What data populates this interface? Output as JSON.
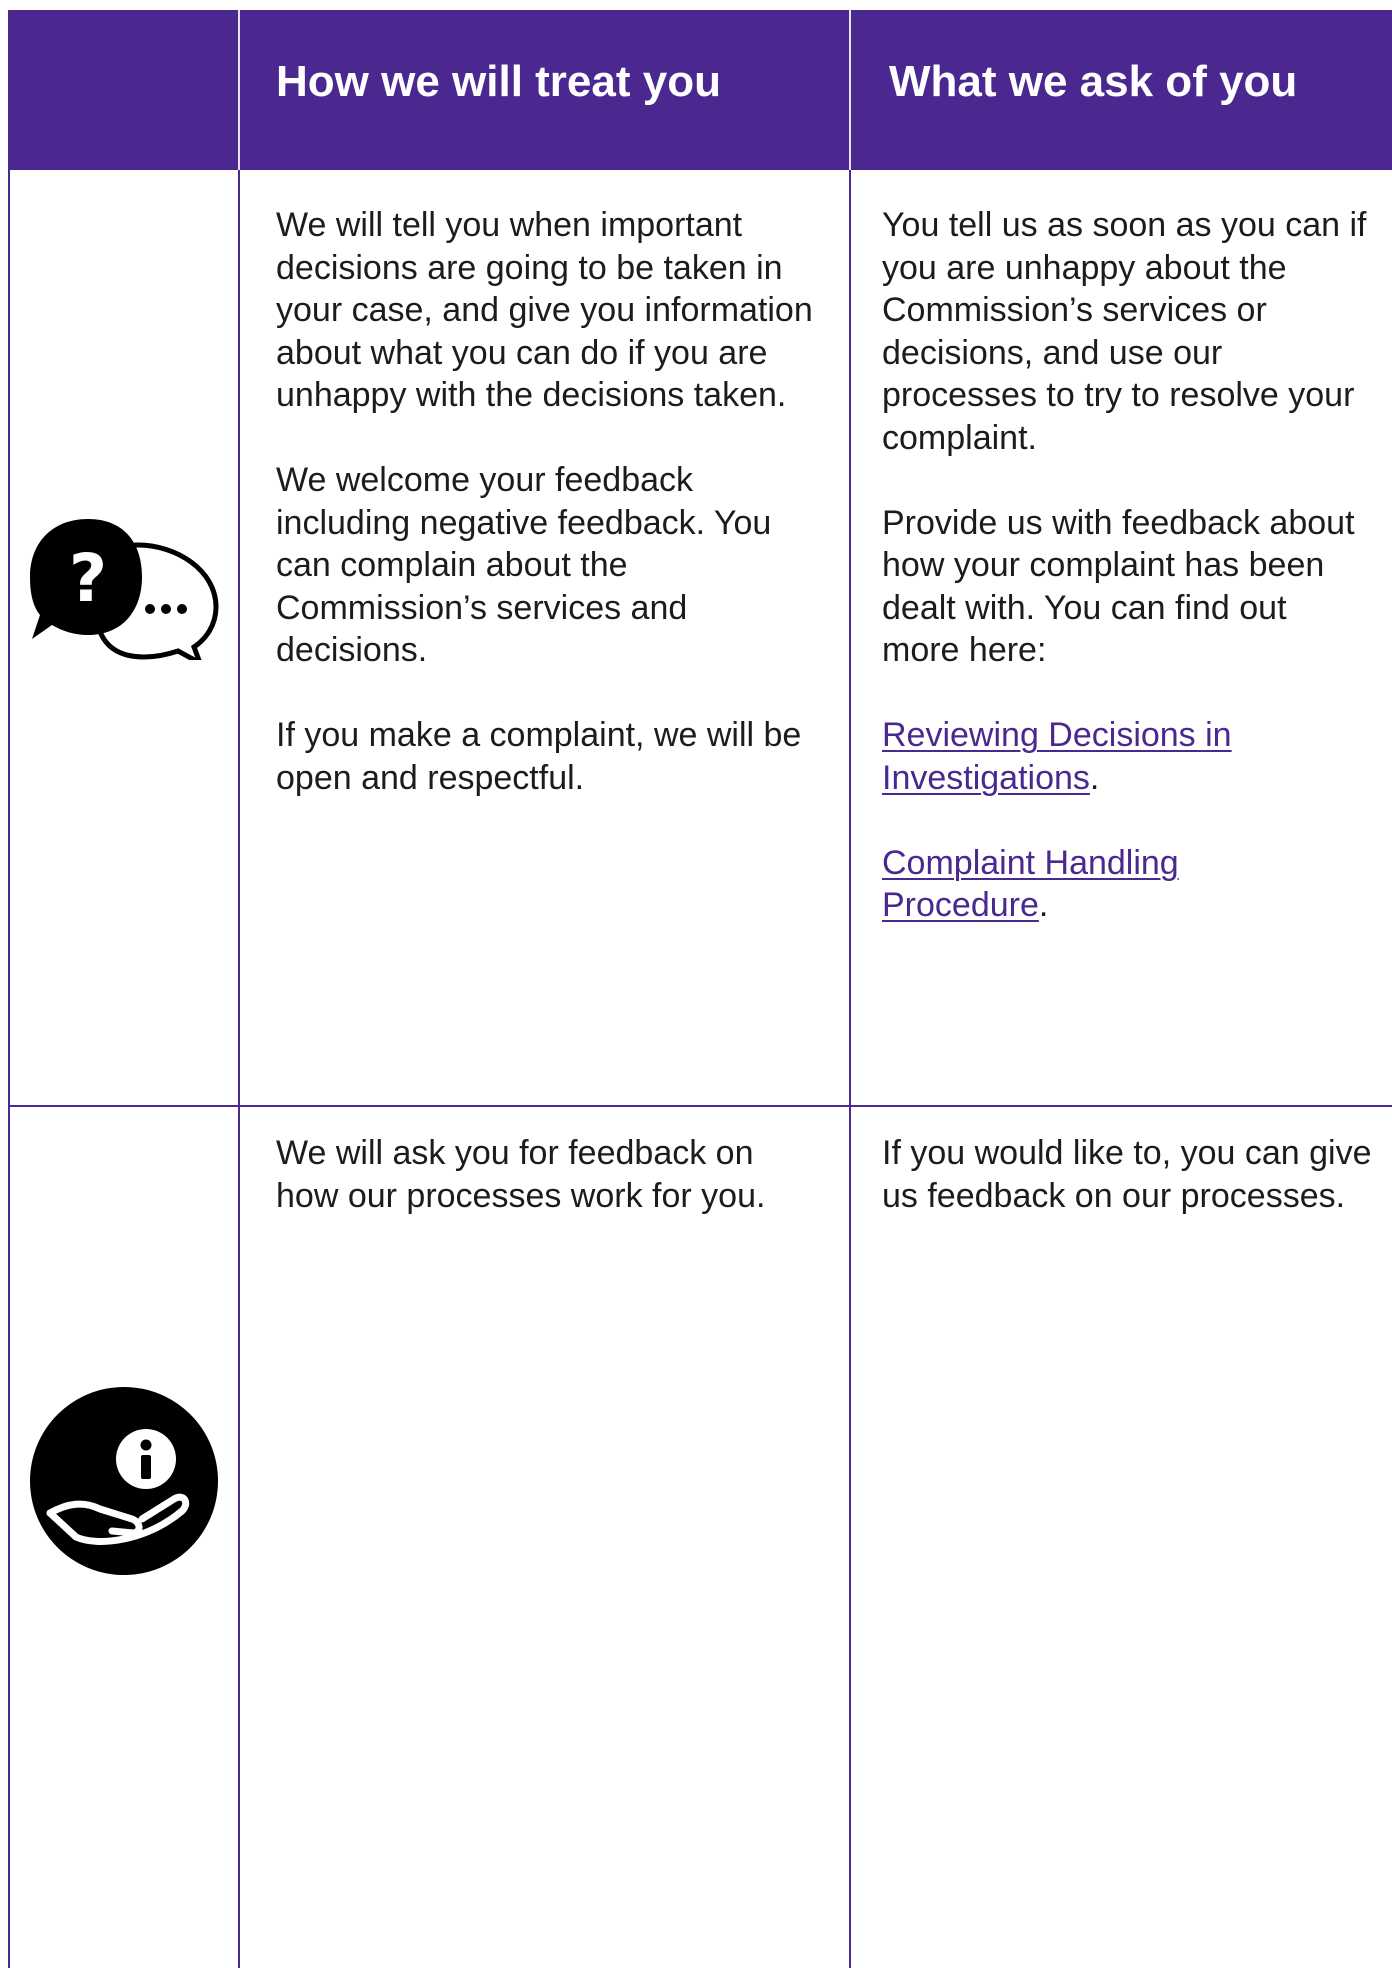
{
  "header": {
    "col_treat": "How we will treat you",
    "col_ask": "What we ask of you"
  },
  "rows": [
    {
      "icon": "question-speech-bubbles-icon",
      "treat": [
        "We will tell you when important decisions are going to be taken in your case, and give you information about what you can do if you are unhappy with the decisions taken.",
        "We welcome your feedback including negative feedback. You can complain about the Commission’s services and decisions.",
        "If you make a complaint, we will be open and respectful."
      ],
      "ask": [
        "You tell us as soon as you can if you are unhappy about the Commission’s services or decisions, and use our processes to try to resolve your complaint.",
        "Provide us with feedback about how your complaint has been dealt with. You can find out more here:"
      ],
      "links": [
        {
          "text": "Reviewing Decisions in Investigations",
          "suffix": "."
        },
        {
          "text": "Complaint Handling Procedure",
          "suffix": "."
        }
      ]
    },
    {
      "icon": "information-hand-icon",
      "treat": [
        "We will ask you for feedback on how our processes work for you."
      ],
      "ask": [
        "If you would like to, you can give us feedback on our processes."
      ]
    }
  ],
  "colors": {
    "header_bg": "#4a2890",
    "link": "#4a2890",
    "rule": "#4b2a8f"
  }
}
